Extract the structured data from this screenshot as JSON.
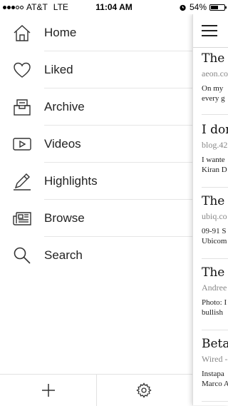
{
  "status_bar": {
    "carrier": "AT&T",
    "network": "LTE",
    "time": "11:04 AM",
    "battery": "54%",
    "battery_level": 0.54,
    "signal_bars_filled": 3,
    "signal_bars_total": 5
  },
  "menu": {
    "items": [
      {
        "label": "Home",
        "icon": "home-icon"
      },
      {
        "label": "Liked",
        "icon": "heart-icon"
      },
      {
        "label": "Archive",
        "icon": "archive-icon"
      },
      {
        "label": "Videos",
        "icon": "video-icon"
      },
      {
        "label": "Highlights",
        "icon": "pen-icon"
      },
      {
        "label": "Browse",
        "icon": "newspaper-icon"
      },
      {
        "label": "Search",
        "icon": "search-icon"
      }
    ]
  },
  "bottom_bar": {
    "add_icon": "plus-icon",
    "settings_icon": "gear-icon"
  },
  "articles": [
    {
      "title": "The p",
      "source": "aeon.co",
      "excerpt_1": "On my",
      "excerpt_2": "every g"
    },
    {
      "title": "I don",
      "source": "blog.42",
      "excerpt_1": "I wante",
      "excerpt_2": "Kiran D"
    },
    {
      "title": "The C",
      "source": "ubiq.co",
      "excerpt_1": "09-91 S",
      "excerpt_2": "Ubicom"
    },
    {
      "title": "The I",
      "source": "Andree",
      "excerpt_1": "Photo: I",
      "excerpt_2": "bullish"
    },
    {
      "title": "Betaw",
      "source": "Wired -",
      "excerpt_1": "Instapa",
      "excerpt_2": "Marco A"
    }
  ],
  "colors": {
    "text": "#222222",
    "muted": "#888888",
    "separator": "#e6e6e6"
  }
}
